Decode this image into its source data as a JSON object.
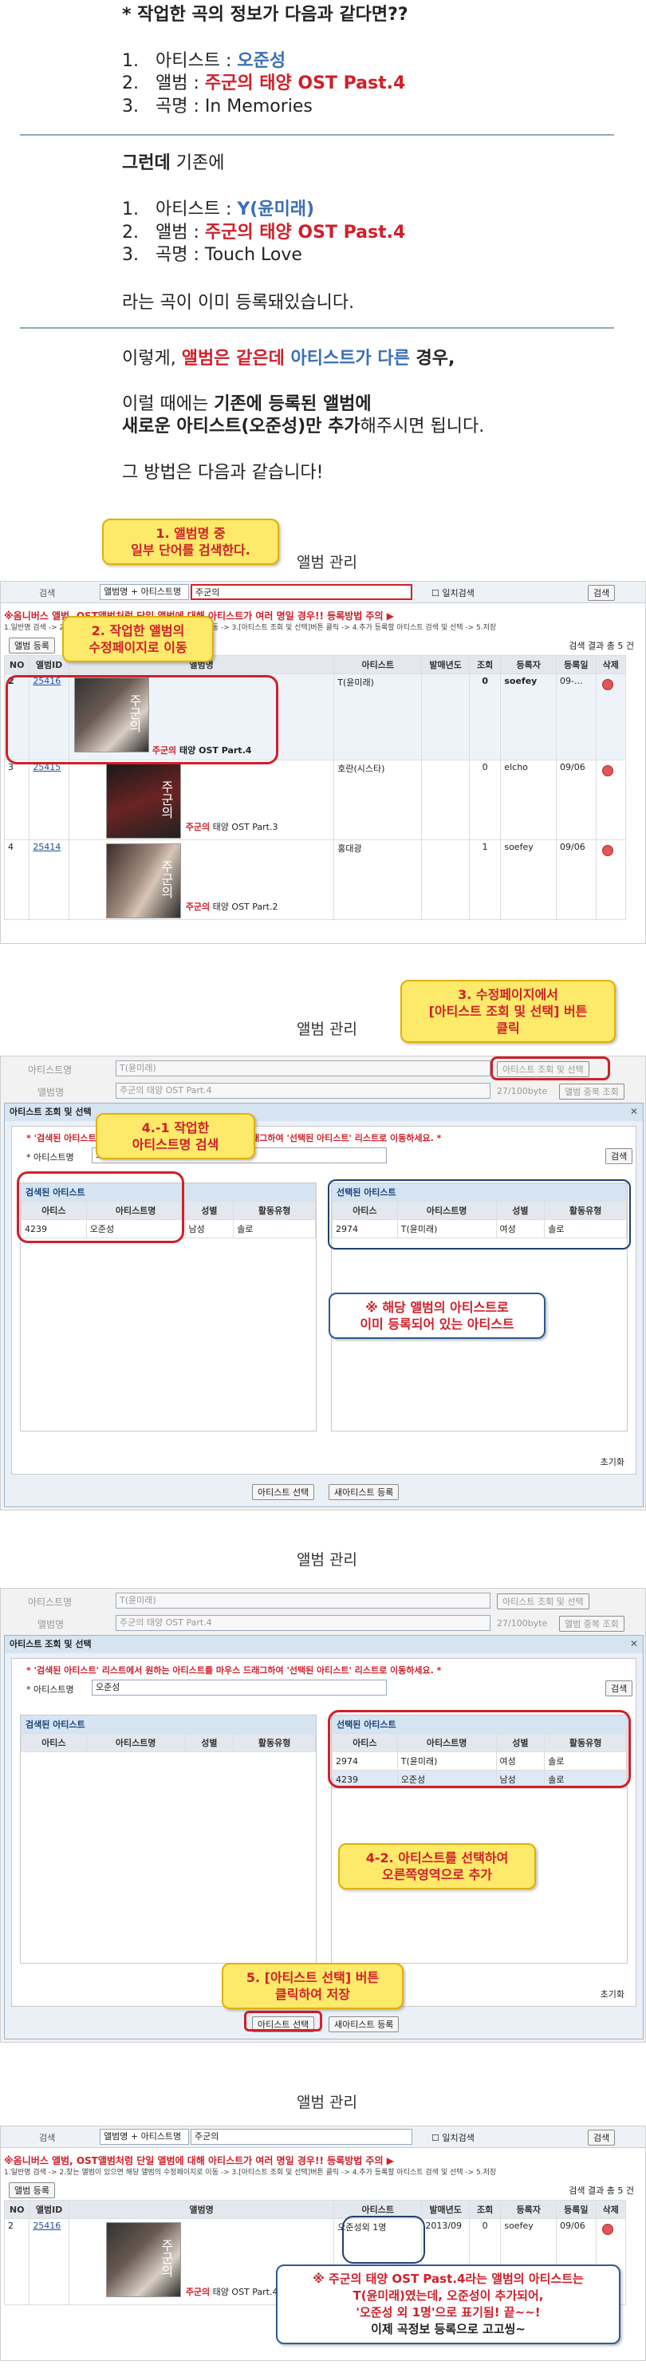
{
  "intro": {
    "heading": "* 작업한 곡의 정보가 다음과 같다면??",
    "items1": [
      {
        "num": "1.",
        "label": "아티스트 : ",
        "value": "오준성"
      },
      {
        "num": "2.",
        "label": "앨범 : ",
        "value": "주군의 태양 OST Past.4"
      },
      {
        "num": "3.",
        "label": "곡명 : ",
        "value": "In Memories"
      }
    ],
    "but_bold": "그런데",
    "but_rest": " 기존에",
    "items2": [
      {
        "num": "1.",
        "label": "아티스트 : ",
        "value": "Y(윤미래)"
      },
      {
        "num": "2.",
        "label": "앨범 : ",
        "value": "주군의 태양 OST Past.4"
      },
      {
        "num": "3.",
        "label": "곡명 : ",
        "value": "Touch Love"
      }
    ],
    "already": "라는 곡이 이미 등록돼있습니다.",
    "p1_a": "이렇게, ",
    "p1_b": "앨범은 같은데",
    "p1_c": " 아티스트가 다른",
    "p1_d": " 경우,",
    "p2_a": "이럴 때에는 ",
    "p2_b": "기존에 등록된 앨범에",
    "p3_a": "새로운 아티스트(오준성)만 추가",
    "p3_b": "해주시면 됩니다.",
    "p4": "그 방법은 다음과 같습니다!"
  },
  "s1": {
    "title": "앨범 관리",
    "search_label": "검색",
    "select_value": "앨범명 + 아티스트명",
    "search_value": "주군의",
    "exact_label": "일치검색",
    "search_btn": "검색",
    "notice": "※옴니버스 앨범, OST앨범처럼 단일 앨범에 대해 아티스트가 여러 명일 경우!! 등록방법 주의 ▶",
    "notice2": "1.일반명 검색 -> 2.찾는 앨범이 있으면 해당 앨범의 수정페이지로 이동 -> 3.[아티스트 조회 및 선택]버튼 클릭 -> 4.추가 등록할 아티스트 검색 및 선택 -> 5.저장",
    "reg_btn": "앨범 등록",
    "result_count": "검색 결과 총 5 건",
    "headers": [
      "NO",
      "앨범ID",
      "앨범명",
      "아티스트",
      "발매년도",
      "조회",
      "등록자",
      "등록일",
      "삭제"
    ],
    "rows": [
      {
        "no": "2",
        "id": "25416",
        "album_red": "주군의",
        "album": " 태양 OST Part.4",
        "artist": "T(윤미래)",
        "year": "",
        "views": "0",
        "user": "soefey",
        "date": "09-..."
      },
      {
        "no": "3",
        "id": "25415",
        "album_red": "주군의",
        "album": " 태양 OST Part.3",
        "artist": "호란(시스타)",
        "year": "",
        "views": "0",
        "user": "elcho",
        "date": "09/06"
      },
      {
        "no": "4",
        "id": "25414",
        "album_red": "주군의",
        "album": " 태양 OST Part.2",
        "artist": "홍대광",
        "year": "",
        "views": "1",
        "user": "soefey",
        "date": "09/06"
      }
    ],
    "callout1": "1.  앨범명 중\n일부 단어를 검색한다.",
    "callout2": "2. 작업한 앨범의\n수정페이지로 이동"
  },
  "s2": {
    "title": "앨범 관리",
    "artist_label": "아티스트명",
    "artist_value": "T(윤미래)",
    "album_label": "앨범명",
    "album_value": "주군의 태양 OST Part.4",
    "artist_btn": "아티스트 조회 및 선택",
    "bytes": "27/100byte",
    "dup_btn": "앨범 중복 조회",
    "dlg_title": "아티스트 조회 및 선택",
    "dlg_notice": "* '검색된 아티스트' 리스트에서 원하는 아티스트를 마우스 드래그하여 '선택된 아티스트' 리스트로 이동하세요. *",
    "dlg_artist_label": "* 아티스트명",
    "dlg_artist_value": "오준성",
    "dlg_search_btn": "검색",
    "left_title": "검색된 아티스트",
    "right_title": "선택된 아티스트",
    "col_headers": [
      "아티스",
      "아티스트명",
      "성별",
      "활동유형"
    ],
    "left_rows": [
      {
        "id": "4239",
        "name": "오준성",
        "gender": "남성",
        "type": "솔로"
      }
    ],
    "right_rows": [
      {
        "id": "2974",
        "name": "T(윤미래)",
        "gender": "여성",
        "type": "솔로"
      }
    ],
    "reset": "초기화",
    "select_btn": "아티스트 선택",
    "new_btn": "새아티스트 등록",
    "callout3": "3. 수정페이지에서\n[아티스트 조회 및 선택] 버튼\n클릭",
    "callout4": "4.-1 작업한\n아티스트명 검색",
    "note": "※ 해당 앨범의 아티스트로\n이미 등록되어 있는 아티스트"
  },
  "s3": {
    "title": "앨범 관리",
    "artist_label": "아티스트명",
    "artist_value": "T(윤미래)",
    "album_label": "앨범명",
    "album_value": "주군의 태양 OST Part.4",
    "artist_btn": "아티스트 조회 및 선택",
    "bytes": "27/100byte",
    "dup_btn": "앨범 중복 조회",
    "dlg_title": "아티스트 조회 및 선택",
    "dlg_notice": "* '검색된 아티스트' 리스트에서 원하는 아티스트를 마우스 드래그하여 '선택된 아티스트' 리스트로 이동하세요. *",
    "dlg_artist_label": "* 아티스트명",
    "dlg_artist_value": "오준성",
    "dlg_search_btn": "검색",
    "left_title": "검색된 아티스트",
    "right_title": "선택된 아티스트",
    "col_headers": [
      "아티스",
      "아티스트명",
      "성별",
      "활동유형"
    ],
    "right_rows": [
      {
        "id": "2974",
        "name": "T(윤미래)",
        "gender": "여성",
        "type": "솔로"
      },
      {
        "id": "4239",
        "name": "오준성",
        "gender": "남성",
        "type": "솔로"
      }
    ],
    "reset": "초기화",
    "select_btn": "아티스트 선택",
    "new_btn": "새아티스트 등록",
    "callout42": "4-2. 아티스트를 선택하여\n오른쪽영역으로 추가",
    "callout5": "5. [아티스트 선택] 버튼\n클릭하여 저장"
  },
  "s4": {
    "title": "앨범 관리",
    "search_label": "검색",
    "select_value": "앨범명 + 아티스트명",
    "search_value": "주군의",
    "exact_label": "일치검색",
    "search_btn": "검색",
    "notice": "※옴니버스 앨범, OST앨범처럼 단일 앨범에 대해 아티스트가 여러 명일 경우!! 등록방법 주의 ▶",
    "notice2": "1.일반명 검색 -> 2.찾는 앨범이 있으면 해당 앨범의 수정페이지로 이동 -> 3.[아티스트 조회 및 선택]버튼 클릭 -> 4.추가 등록할 아티스트 검색 및 선택 -> 5.저장",
    "reg_btn": "앨범 등록",
    "result_count": "검색 결과 총 5 건",
    "headers": [
      "NO",
      "앨범ID",
      "앨범명",
      "아티스트",
      "발매년도",
      "조회",
      "등록자",
      "등록일",
      "삭제"
    ],
    "row": {
      "no": "2",
      "id": "25416",
      "album_red": "주군의",
      "album": " 태양 OST Part.4",
      "artist": "오준성외 1명",
      "year": "2013/09",
      "views": "0",
      "user": "soefey",
      "date": "09/06"
    },
    "final": "※ 주군의 태양 OST Past.4라는 앨범의 아티스트는\nT(윤미래)였는데, 오준성이 추가되어,\n'오준성 외 1명'으로 표기됨! 끝~~!",
    "final_b": "이제 곡정보 등록으로 고고씽~"
  }
}
